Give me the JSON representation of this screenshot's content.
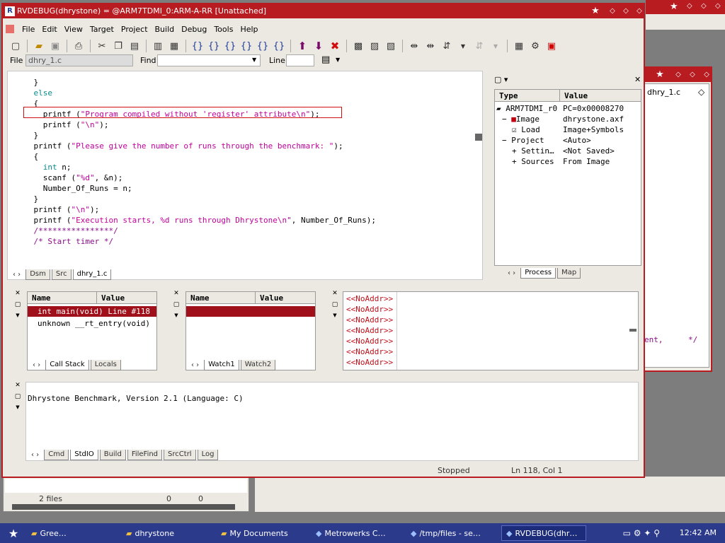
{
  "main_window": {
    "title": "RVDEBUG(dhrystone) = @ARM7TDMI_0:ARM-A-RR [Unattached]"
  },
  "menu": [
    "File",
    "Edit",
    "View",
    "Target",
    "Project",
    "Build",
    "Debug",
    "Tools",
    "Help"
  ],
  "filebar": {
    "file_label": "File",
    "file_value": "dhry_1.c",
    "find_label": "Find",
    "find_value": "",
    "line_label": "Line",
    "line_value": ""
  },
  "code": {
    "lines": [
      {
        "t": "    }",
        "c": "pl"
      },
      {
        "t": "    else",
        "c": "kw"
      },
      {
        "t": "    {",
        "c": "pl"
      },
      {
        "t": "      printf (\"Program compiled without 'register' attribute\\n\");",
        "c": "mix1"
      },
      {
        "t": "      printf (\"\\n\");",
        "c": "mix2"
      },
      {
        "t": "    }",
        "c": "pl"
      },
      {
        "t": "    printf (\"Please give the number of runs through the benchmark: \");",
        "c": "mix3"
      },
      {
        "t": "    {",
        "c": "pl"
      },
      {
        "t": "      int n;",
        "c": "mix4"
      },
      {
        "t": "      scanf (\"%d\", &n);",
        "c": "mix5"
      },
      {
        "t": "      Number_Of_Runs = n;",
        "c": "pl"
      },
      {
        "t": "    }",
        "c": "pl"
      },
      {
        "t": "    printf (\"\\n\");",
        "c": "mix6"
      },
      {
        "t": "",
        "c": "pl"
      },
      {
        "t": "    printf (\"Execution starts, %d runs through Dhrystone\\n\", Number_Of_Runs);",
        "c": "mix7"
      },
      {
        "t": "",
        "c": "pl"
      },
      {
        "t": "    /****************/",
        "c": "cm"
      },
      {
        "t": "    /* Start timer */",
        "c": "cm"
      }
    ]
  },
  "code_tabs": [
    "Dsm",
    "Src",
    "dhry_1.c"
  ],
  "process": {
    "col_type": "Type",
    "col_value": "Value",
    "rows": [
      {
        "type": "ARM7TDMI_r0",
        "value": "PC=0x00008270"
      },
      {
        "type": "Image",
        "value": "dhrystone.axf"
      },
      {
        "type": "Load",
        "value": "Image+Symbols"
      },
      {
        "type": "Project",
        "value": "<Auto>"
      },
      {
        "type": "Settin…",
        "value": "<Not Saved>"
      },
      {
        "type": "Sources",
        "value": "From Image"
      }
    ],
    "tabs": [
      "Process",
      "Map"
    ]
  },
  "callstack": {
    "col_name": "Name",
    "col_value": "Value",
    "rows": [
      "int main(void) Line #118",
      "unknown __rt_entry(void)"
    ],
    "tabs": [
      "Call Stack",
      "Locals"
    ]
  },
  "watch": {
    "col_name": "Name",
    "col_value": "Value",
    "tabs": [
      "Watch1",
      "Watch2"
    ]
  },
  "memory": {
    "rows": [
      "<<NoAddr>>",
      "<<NoAddr>>",
      "<<NoAddr>>",
      "<<NoAddr>>",
      "<<NoAddr>>",
      "<<NoAddr>>",
      "<<NoAddr>>"
    ]
  },
  "output": {
    "text": "Dhrystone Benchmark, Version 2.1 (Language: C)",
    "tabs": [
      "Cmd",
      "StdIO",
      "Build",
      "FileFind",
      "SrcCtrl",
      "Log"
    ]
  },
  "status": {
    "state": "Stopped",
    "pos": "Ln 118, Col 1"
  },
  "back_window": {
    "file": "dhry_1.c",
    "frag1": "ent,",
    "frag2": "*/"
  },
  "explorer": {
    "files": "2 files",
    "n1": "0",
    "n2": "0"
  },
  "taskbar": {
    "items": [
      {
        "label": "Gree…",
        "icon": "folder-icon"
      },
      {
        "label": "dhrystone",
        "icon": "folder-icon"
      },
      {
        "label": "My Documents",
        "icon": "folder-icon"
      },
      {
        "label": "Metrowerks C…",
        "icon": "app-icon"
      },
      {
        "label": "/tmp/files - se…",
        "icon": "app-icon"
      },
      {
        "label": "RVDEBUG(dhr…",
        "icon": "app-icon"
      }
    ],
    "clock": "12:42 AM"
  }
}
